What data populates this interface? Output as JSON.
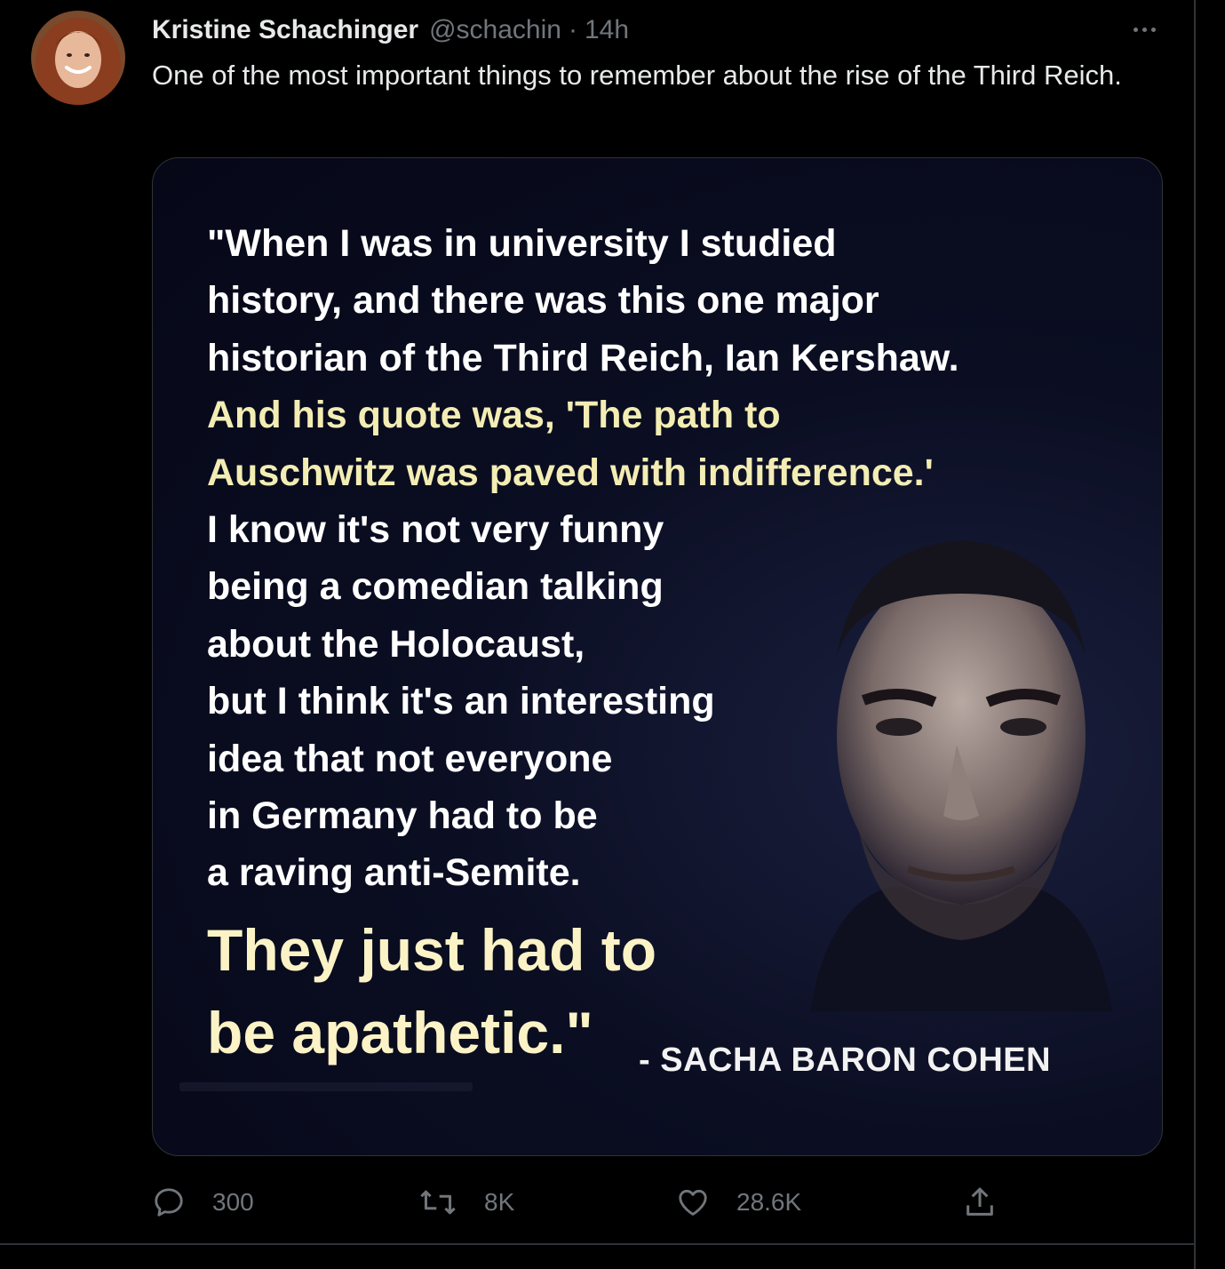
{
  "tweet": {
    "author": {
      "display_name": "Kristine Schachinger",
      "handle": "@schachin"
    },
    "separator": "·",
    "timestamp": "14h",
    "text": "One of the most important things to remember about the rise of the Third Reich."
  },
  "media": {
    "quote_lines_white_1": [
      "\"When I was in university I studied",
      "history, and there was this one major",
      "historian of the Third Reich, Ian Kershaw."
    ],
    "quote_lines_yellow": [
      "And his quote was, 'The path to",
      "Auschwitz was paved with indifference.'"
    ],
    "quote_lines_white_2": [
      "I know it's not very funny",
      "being a comedian talking",
      "about the Holocaust,",
      "but I think it's an interesting",
      "idea that not everyone",
      "in Germany had to be",
      "a raving anti-Semite."
    ],
    "quote_lines_big": [
      "They just had to",
      "be apathetic.\""
    ],
    "attribution": "- SACHA BARON COHEN"
  },
  "actions": {
    "reply_count": "300",
    "retweet_count": "8K",
    "like_count": "28.6K"
  },
  "icons": {
    "reply": "reply-icon",
    "retweet": "retweet-icon",
    "like": "heart-icon",
    "share": "share-icon",
    "more": "more-icon"
  },
  "colors": {
    "background": "#000000",
    "text_primary": "#e7e9ea",
    "text_secondary": "#71767b",
    "quote_yellow": "#f3edb4",
    "divider": "#2f3336"
  }
}
